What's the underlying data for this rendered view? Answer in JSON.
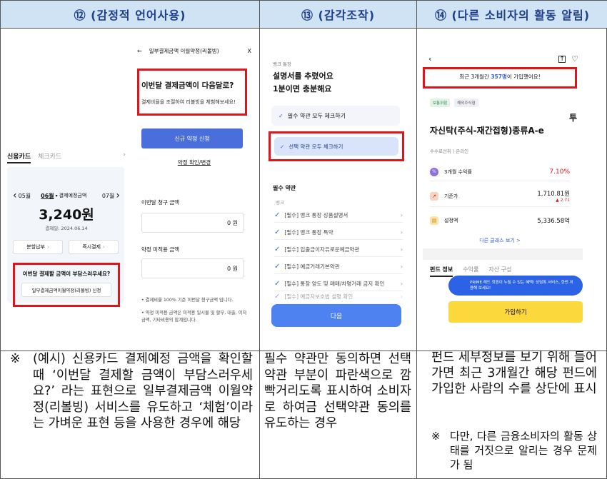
{
  "headers": {
    "col1": "⑫ (감정적 언어사용)",
    "col2": "⑬ (감각조작)",
    "col3": "⑭ (다른 소비자의 활동 알림)"
  },
  "panel1_left": {
    "tab_credit": "신용카드",
    "tab_check": "체크카드",
    "month_prev": "05월",
    "month_cur": "06월",
    "due_label": "결제예정금액",
    "month_next": "07월",
    "amount": "3,240원",
    "due_date": "결제일: 2024.06.14",
    "btn_installment": "분할납부",
    "btn_immediate": "즉시결제",
    "prompt": "이번달 결제할 금액이 부담스러우세요?",
    "revolving_btn": "일부결제금액이월약정(리볼빙) 신청"
  },
  "panel1_right": {
    "back": "←",
    "title": "일부결제금액 이월약정(리볼빙)",
    "close": "X",
    "headline": "이번달 결제금액이 다음달로?",
    "subline": "결제비율을 조절하여 리볼빙을 체험해보세요!",
    "new_btn": "신규 약정 신청",
    "confirm_link": "약정 확인/변경",
    "bill_label": "이번달 청구 금액",
    "bill_value": "0 원",
    "unpaid_label": "약정 미적용 금액",
    "unpaid_value": "0 원",
    "note1": "• 결제비율 100% 기준 이번달 청구금액 입니다.",
    "note2": "• 약정 미적용 금액은 미적용 일시불 및 할부, 대출, 이자금액, 기타비용의 합계입니다."
  },
  "panel2": {
    "app": "뱅크 통장",
    "title1": "설명서를 추렸어요",
    "title2": "1분이면 충분해요",
    "opt_required": "필수 약관 모두 체크하기",
    "opt_selected": "선택 약관 모두 체크하기",
    "section": "필수 약관",
    "section_sub": "뱅크",
    "items": [
      "[필수] 뱅크 통장 상품설명서",
      "[필수] 뱅크 통장 특약",
      "[필수] 입출금이자유로운예금약관",
      "[필수] 예금거래기본약관",
      "[필수] 통장 양도 및 매매/차명거래 금지 확인",
      "[필수] 예금자보호법 설명 확인"
    ],
    "next_btn": "다음"
  },
  "panel3": {
    "banner": "최근 3개월간 357명이 가입했어요!",
    "banner_pre": "최근 3개월간 ",
    "banner_num": "357명",
    "banner_post": "이 가입했어요!",
    "tag1": "보통위험",
    "tag2": "해외주식형",
    "fund_name1": "투",
    "fund_name2": "자신탁(주식-재간접형)종류A-e",
    "meta": "수수료선취 | 온라인",
    "rows": [
      {
        "label": "3개월 수익률",
        "value": "7.10%",
        "sub": ""
      },
      {
        "label": "기준가",
        "value": "1,710.81원",
        "sub": "▲ 2.71"
      },
      {
        "label": "설정액",
        "value": "5,336.58억",
        "sub": ""
      }
    ],
    "other_class": "다른 클래스 보기 >",
    "tabs": [
      "펀드 정보",
      "수익률",
      "자산 구성"
    ],
    "toast": "PRIME 레드 회원이 누릴 수 있는 혜택! 상담톡 서비스, 한번 이용해 보세요!",
    "join_btn": "가입하기"
  },
  "descriptions": {
    "col1_mark": "※",
    "col1": "(예시) 신용카드 결제예정 금액을 확인할 때 ‘이번달 결제할 금액이 부담스러우세요?’ 라는 표현으로 일부결제금액 이월약정(리볼빙) 서비스를 유도하고 ‘체험’이라는 가벼운 표현 등을 사용한 경우에 해당",
    "col2": "필수 약관만 동의하면 선택 약관 부분이 파란색으로 깜빡거리도록 표시하여 소비자로 하여금 선택약관 동의를 유도하는 경우",
    "col3": "펀드 세부정보를 보기 위해 들어가면 최근 3개월간 해당 펀드에 가입한 사람의 수를 상단에 표시",
    "col3_note_mark": "※",
    "col3_note": "다만, 다른 금융소비자의 활동 상태를 거짓으로 알리는 경우 문제가 됨"
  },
  "colors": {
    "header_bg": "#cfe3f5",
    "header_text": "#1f3d8a",
    "red": "#e0151b",
    "blue": "#4a6fdc",
    "yellow": "#fbd83c"
  }
}
